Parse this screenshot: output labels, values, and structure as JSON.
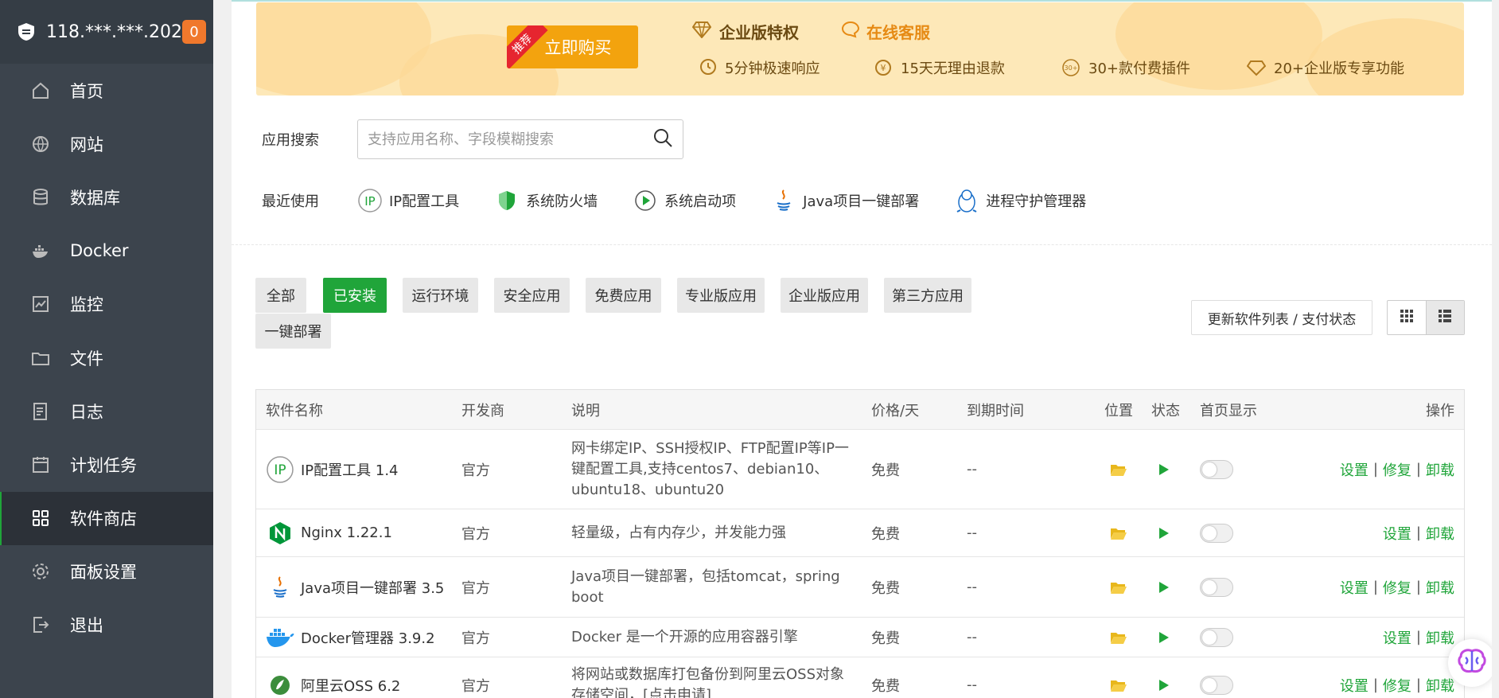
{
  "sidebar": {
    "server_ip": "118.***.***.202",
    "badge": "0",
    "items": [
      {
        "label": "首页",
        "icon": "home-icon"
      },
      {
        "label": "网站",
        "icon": "globe-icon"
      },
      {
        "label": "数据库",
        "icon": "database-icon"
      },
      {
        "label": "Docker",
        "icon": "docker-icon"
      },
      {
        "label": "监控",
        "icon": "monitor-icon"
      },
      {
        "label": "文件",
        "icon": "folder-icon"
      },
      {
        "label": "日志",
        "icon": "log-icon"
      },
      {
        "label": "计划任务",
        "icon": "calendar-icon"
      },
      {
        "label": "软件商店",
        "icon": "grid-icon",
        "active": true
      },
      {
        "label": "面板设置",
        "icon": "gear-icon"
      },
      {
        "label": "退出",
        "icon": "logout-icon"
      }
    ]
  },
  "banner": {
    "buy_label": "立即购买",
    "ribbon": "推荐",
    "enterprise_title": "企业版特权",
    "online_service": "在线客服",
    "features": [
      "5分钟极速响应",
      "15天无理由退款",
      "30+款付费插件",
      "20+企业版专享功能"
    ]
  },
  "search": {
    "label": "应用搜索",
    "placeholder": "支持应用名称、字段模糊搜索"
  },
  "recent": {
    "label": "最近使用",
    "items": [
      "IP配置工具",
      "系统防火墙",
      "系统启动项",
      "Java项目一键部署",
      "进程守护管理器"
    ]
  },
  "categories": [
    "全部",
    "已安装",
    "运行环境",
    "安全应用",
    "免费应用",
    "专业版应用",
    "企业版应用",
    "第三方应用",
    "一键部署"
  ],
  "active_category": "已安装",
  "refresh_label": "更新软件列表 / 支付状态",
  "table": {
    "headers": {
      "name": "软件名称",
      "dev": "开发商",
      "desc": "说明",
      "price": "价格/天",
      "expire": "到期时间",
      "loc": "位置",
      "state": "状态",
      "home": "首页显示",
      "ops": "操作"
    },
    "rows": [
      {
        "name": "IP配置工具 1.4",
        "dev": "官方",
        "desc": "网卡绑定IP、SSH授权IP、FTP配置IP等IP一键配置工具,支持centos7、debian10、ubuntu18、ubuntu20",
        "price": "免费",
        "expire": "--",
        "ops": [
          "设置",
          "修复",
          "卸载"
        ]
      },
      {
        "name": "Nginx 1.22.1",
        "dev": "官方",
        "desc": "轻量级，占有内存少，并发能力强",
        "price": "免费",
        "expire": "--",
        "ops": [
          "设置",
          "卸载"
        ]
      },
      {
        "name": "Java项目一键部署 3.5",
        "dev": "官方",
        "desc": "Java项目一键部署，包括tomcat，spring boot",
        "price": "免费",
        "expire": "--",
        "ops": [
          "设置",
          "修复",
          "卸载"
        ]
      },
      {
        "name": "Docker管理器 3.9.2",
        "dev": "官方",
        "desc": "Docker 是一个开源的应用容器引擎",
        "price": "免费",
        "expire": "--",
        "ops": [
          "设置",
          "卸载"
        ]
      },
      {
        "name": "阿里云OSS 6.2",
        "dev": "官方",
        "desc": "将网站或数据库打包备份到阿里云OSS对象存储空间，[点击申请]",
        "price": "免费",
        "expire": "--",
        "ops": [
          "设置",
          "修复",
          "卸载"
        ]
      }
    ]
  },
  "colors": {
    "accent": "#20a53a",
    "sidebar": "#3c444d",
    "banner_button": "#f3a30e"
  }
}
